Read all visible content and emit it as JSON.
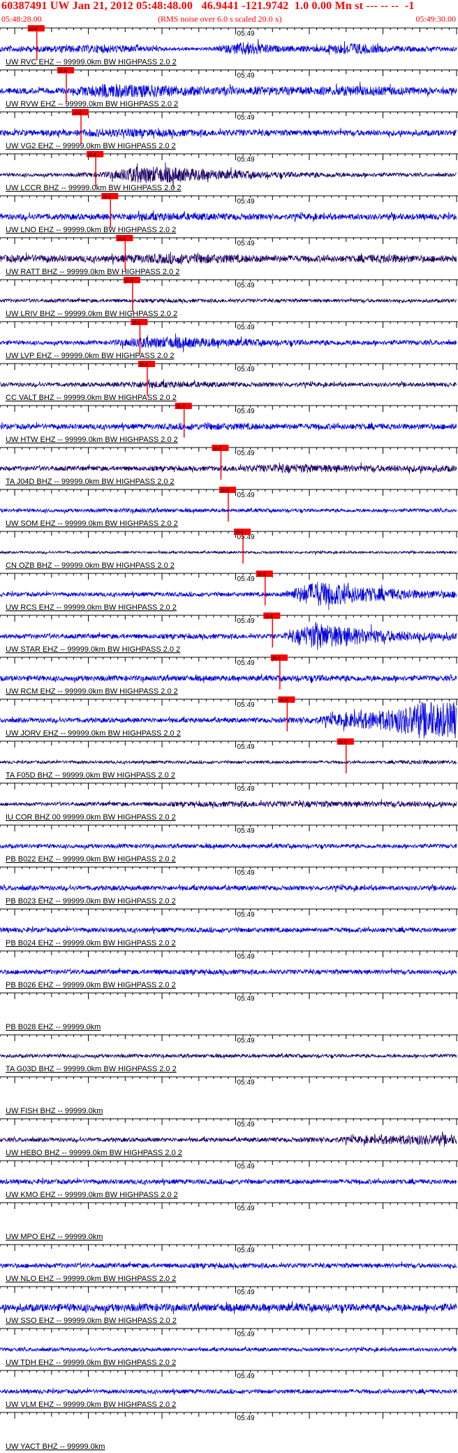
{
  "header": {
    "title": "60387491 UW Jan 21, 2012 05:48:48.00   46.9441 -121.9742  1.0 0.00 Mn st --- -- --  -1",
    "start_time": "05:48:28.00",
    "note": "(RMS noise over 6.0 s scaled 20.0 x)",
    "end_time": "05:49:30.00"
  },
  "colors": {
    "header_text": "#ff0000",
    "trace_blue": "#0000dd",
    "trace_dark": "#1a0066",
    "pick_red": "#ff0000",
    "axis_black": "#000000"
  },
  "time_axis": {
    "start": "05:48:28.00",
    "end": "05:49:30.00",
    "minute_tick_label": "05:49"
  },
  "pick_label": "st-4",
  "chart_data": {
    "type": "seismogram",
    "time_range": [
      "05:48:28.00",
      "05:49:30.00"
    ],
    "traces": [
      {
        "label": "UW RVC EHZ -- 99999.0km BW  HIGHPASS  2.0  2",
        "pick": "05:48:33",
        "onset": "05:49:03",
        "env": [
          1,
          1,
          1.2,
          1.5,
          1,
          0.6,
          0.5,
          2.5,
          1,
          1.1,
          2.2,
          1,
          0.9,
          0.8
        ],
        "color": "blue"
      },
      {
        "label": "UW RVW EHZ -- 99999.0km BW  HIGHPASS  2.0  2",
        "pick": "05:48:37",
        "onset": "05:48:37",
        "env": [
          1,
          1,
          1,
          2.5,
          2.2,
          1.8,
          1.5,
          1.3,
          1.5,
          1.4,
          1.8,
          1.5,
          1.2,
          1
        ],
        "color": "blue"
      },
      {
        "label": "UW VG2 EHZ -- 99999.0km BW  HIGHPASS  2.0  2",
        "pick": "05:48:39",
        "onset": "05:48:39",
        "env": [
          1,
          1,
          1,
          1.5,
          1.3,
          1.2,
          1.1,
          1.1,
          1,
          1,
          1,
          1,
          1,
          1
        ],
        "color": "blue"
      },
      {
        "label": "UW LCCR BHZ -- 99999.0km BW  HIGHPASS  2.0  2",
        "pick": "05:48:41",
        "onset": "05:48:41",
        "env": [
          0.6,
          0.6,
          0.6,
          1,
          3,
          2.6,
          1.8,
          1.3,
          1,
          0.9,
          0.8,
          0.7,
          0.6,
          0.6
        ],
        "color": "dark"
      },
      {
        "label": "UW LNO EHZ -- 99999.0km BW  HIGHPASS  2.0  2",
        "pick": "05:48:43",
        "onset": "05:48:43",
        "env": [
          1,
          1,
          1,
          1,
          1.4,
          1.3,
          1.2,
          1.1,
          1,
          1,
          1,
          1,
          1,
          1
        ],
        "color": "blue"
      },
      {
        "label": "UW RATT BHZ -- 99999.0km BW  HIGHPASS  2.0  2",
        "pick": "05:48:45",
        "onset": "05:48:45",
        "env": [
          1.2,
          1.3,
          1.1,
          1.1,
          1.5,
          1.8,
          1.6,
          1.3,
          1.2,
          1.1,
          1.1,
          1.6,
          1.2,
          1.1
        ],
        "color": "dark"
      },
      {
        "label": "UW LRIV BHZ -- 99999.0km BW  HIGHPASS  2.0  2",
        "pick": "05:48:46",
        "onset": "05:48:46",
        "env": [
          0.6,
          0.6,
          0.6,
          0.6,
          0.6,
          0.6,
          0.6,
          0.6,
          0.6,
          0.6,
          0.6,
          0.6,
          0.6,
          0.6
        ],
        "color": "dark"
      },
      {
        "label": "UW LVP EHZ -- 99999.0km BW  HIGHPASS  2.0  2",
        "pick": "05:48:47",
        "onset": "05:48:47",
        "env": [
          0.7,
          0.7,
          0.7,
          0.7,
          1.8,
          2,
          1.5,
          1.2,
          1,
          0.9,
          0.9,
          0.8,
          0.8,
          0.7
        ],
        "color": "blue"
      },
      {
        "label": "CC VALT BHZ -- 99999.0km BW  HIGHPASS  2.0  2",
        "pick": "05:48:48",
        "onset": "05:48:48",
        "env": [
          0.7,
          0.7,
          0.7,
          0.7,
          1.2,
          1.1,
          0.9,
          0.8,
          0.8,
          0.7,
          0.7,
          0.7,
          0.7,
          0.7
        ],
        "color": "dark"
      },
      {
        "label": "UW HTW EHZ -- 99999.0km BW  HIGHPASS  2.0  2",
        "pick": "05:48:53",
        "onset": "05:48:53",
        "env": [
          0.9,
          0.9,
          0.9,
          0.9,
          0.9,
          1,
          1.2,
          1.1,
          1,
          1,
          1,
          1,
          1,
          1
        ],
        "color": "blue"
      },
      {
        "label": "TA J04D BHZ -- 99999.0km BW  HIGHPASS  2.0  2",
        "pick": "05:48:58",
        "onset": "05:48:58",
        "env": [
          0.8,
          0.8,
          0.8,
          0.8,
          0.8,
          0.8,
          0.8,
          1.1,
          1.5,
          1.4,
          1.2,
          1.1,
          1.2,
          1.1
        ],
        "color": "dark"
      },
      {
        "label": "UW SOM EHZ -- 99999.0km BW  HIGHPASS  2.0  2",
        "pick": "05:48:59",
        "onset": "05:48:59",
        "env": [
          0.6,
          0.6,
          0.6,
          0.6,
          0.8,
          0.6,
          0.6,
          0.6,
          0.6,
          0.6,
          0.6,
          0.6,
          0.6,
          0.6
        ],
        "color": "blue"
      },
      {
        "label": "CN OZB BHZ -- 99999.0km BW  HIGHPASS  2.0  2",
        "pick": "05:49:01",
        "onset": "05:49:01",
        "env": [
          0.4,
          0.4,
          0.4,
          0.4,
          0.4,
          0.4,
          0.4,
          0.4,
          0.4,
          0.4,
          0.4,
          0.4,
          0.4,
          0.4
        ],
        "color": "dark"
      },
      {
        "label": "UW RCS EHZ -- 99999.0km BW  HIGHPASS  2.0  2",
        "pick": "05:49:04",
        "onset": "05:49:04",
        "env": [
          0.7,
          0.7,
          0.7,
          0.7,
          0.7,
          0.7,
          0.7,
          0.7,
          0.7,
          4.5,
          3,
          2,
          1.5,
          1.2
        ],
        "color": "blue"
      },
      {
        "label": "UW STAR EHZ -- 99999.0km BW  HIGHPASS  2.0  2",
        "pick": "05:49:05",
        "onset": "05:49:05",
        "env": [
          0.8,
          0.8,
          0.8,
          0.8,
          0.8,
          0.8,
          0.8,
          0.8,
          0.8,
          4.5,
          3,
          2,
          1.5,
          1.3
        ],
        "color": "blue"
      },
      {
        "label": "UW RCM EHZ -- 99999.0km BW  HIGHPASS  2.0  2",
        "pick": "05:49:06",
        "onset": "05:49:06",
        "env": [
          0.9,
          0.9,
          0.9,
          0.9,
          0.9,
          0.9,
          0.9,
          0.9,
          0.9,
          1.1,
          1,
          1,
          0.9,
          0.9
        ],
        "color": "blue"
      },
      {
        "label": "UW JORV EHZ -- 99999.0km BW  HIGHPASS  2.0  2",
        "pick": "05:49:07",
        "onset": "05:49:07",
        "env": [
          0.8,
          0.8,
          0.8,
          0.8,
          0.8,
          0.8,
          0.8,
          0.8,
          0.9,
          1.2,
          2.5,
          3.5,
          6,
          6
        ],
        "color": "blue"
      },
      {
        "label": "TA F05D BHZ -- 99999.0km BW  HIGHPASS  2.0  2",
        "pick": "05:49:15",
        "onset": "05:49:15",
        "env": [
          0.5,
          0.5,
          0.5,
          0.5,
          0.5,
          0.5,
          0.5,
          0.5,
          0.5,
          0.5,
          0.5,
          0.5,
          0.8,
          0.6
        ],
        "color": "dark"
      },
      {
        "label": "IU COR BHZ 00 99999.0km BW  HIGHPASS  2.0  2",
        "pick": null,
        "onset": null,
        "env": [
          0.6,
          0.6,
          0.6,
          0.7,
          0.7,
          0.8,
          0.9,
          1,
          1,
          1.1,
          1,
          1,
          1,
          0.9
        ],
        "color": "dark"
      },
      {
        "label": "PB B022 EHZ -- 99999.0km BW  HIGHPASS  2.0  2",
        "pick": null,
        "onset": null,
        "env": [
          0.7,
          0.7,
          0.7,
          0.7,
          0.7,
          0.7,
          0.7,
          0.7,
          0.7,
          0.7,
          0.7,
          0.7,
          0.7,
          0.7
        ],
        "color": "blue"
      },
      {
        "label": "PB B023 EHZ -- 99999.0km BW  HIGHPASS  2.0  2",
        "pick": null,
        "onset": null,
        "env": [
          0.8,
          0.8,
          0.8,
          0.8,
          0.8,
          0.8,
          0.8,
          0.8,
          0.8,
          0.8,
          0.8,
          0.8,
          0.8,
          0.8
        ],
        "color": "blue"
      },
      {
        "label": "PB B024 EHZ -- 99999.0km BW  HIGHPASS  2.0  2",
        "pick": null,
        "onset": null,
        "env": [
          0.8,
          0.8,
          0.8,
          0.8,
          0.8,
          0.8,
          0.8,
          0.8,
          0.8,
          0.8,
          0.8,
          0.8,
          0.8,
          0.8
        ],
        "color": "blue"
      },
      {
        "label": "PB B026 EHZ -- 99999.0km BW  HIGHPASS  2.0  2",
        "pick": null,
        "onset": null,
        "env": [
          0.8,
          0.8,
          0.8,
          0.8,
          0.8,
          0.9,
          0.8,
          0.8,
          0.8,
          0.8,
          0.8,
          0.8,
          0.8,
          0.8
        ],
        "color": "blue"
      },
      {
        "label": "PB B028 EHZ -- 99999.0km",
        "pick": null,
        "onset": null,
        "env": [
          0,
          0,
          0,
          0,
          0,
          0,
          0,
          0,
          0,
          0,
          0,
          0,
          0,
          0
        ],
        "color": "blue"
      },
      {
        "label": "TA G03D BHZ -- 99999.0km BW  HIGHPASS  2.0  2",
        "pick": null,
        "onset": null,
        "env": [
          0.6,
          0.6,
          0.6,
          0.6,
          0.6,
          0.6,
          0.6,
          0.6,
          0.6,
          0.6,
          0.6,
          0.6,
          0.6,
          0.6
        ],
        "color": "dark"
      },
      {
        "label": "UW FISH BHZ -- 99999.0km",
        "pick": null,
        "onset": null,
        "env": [
          0,
          0,
          0,
          0,
          0,
          0,
          0,
          0,
          0,
          0,
          0,
          0,
          0,
          0
        ],
        "color": "blue"
      },
      {
        "label": "UW HEBO BHZ -- 99999.0km BW  HIGHPASS  2.0  2",
        "pick": null,
        "onset": null,
        "env": [
          0.7,
          0.7,
          0.7,
          0.7,
          0.7,
          0.7,
          0.7,
          0.7,
          0.8,
          0.9,
          1.1,
          1.5,
          1.8,
          1.6
        ],
        "color": "dark"
      },
      {
        "label": "UW KMO EHZ -- 99999.0km BW  HIGHPASS  2.0  2",
        "pick": null,
        "onset": null,
        "env": [
          0.8,
          0.8,
          0.8,
          0.8,
          0.8,
          0.8,
          0.8,
          0.8,
          0.8,
          0.8,
          0.8,
          0.8,
          0.8,
          0.8
        ],
        "color": "blue"
      },
      {
        "label": "UW MPO EHZ -- 99999.0km",
        "pick": null,
        "onset": null,
        "env": [
          0,
          0,
          0,
          0,
          0,
          0,
          0,
          0,
          0,
          0,
          0,
          0,
          0,
          0
        ],
        "color": "blue"
      },
      {
        "label": "UW NLO EHZ -- 99999.0km BW  HIGHPASS  2.0  2",
        "pick": null,
        "onset": null,
        "env": [
          0.8,
          0.8,
          0.8,
          0.8,
          0.8,
          0.8,
          0.8,
          0.8,
          0.8,
          0.8,
          0.8,
          0.8,
          0.8,
          0.8
        ],
        "color": "blue"
      },
      {
        "label": "UW SSO EHZ -- 99999.0km BW  HIGHPASS  2.0  2",
        "pick": null,
        "onset": null,
        "env": [
          1.3,
          1.3,
          1.3,
          1.3,
          1.3,
          1.3,
          1.3,
          1.3,
          1.3,
          1.3,
          1.3,
          1.3,
          1.3,
          1.3
        ],
        "color": "blue"
      },
      {
        "label": "UW TDH EHZ -- 99999.0km BW  HIGHPASS  2.0  2",
        "pick": null,
        "onset": null,
        "env": [
          0.6,
          0.6,
          0.6,
          0.6,
          0.6,
          0.6,
          0.6,
          0.6,
          0.6,
          0.6,
          0.6,
          0.6,
          0.6,
          0.6
        ],
        "color": "blue"
      },
      {
        "label": "UW VLM EHZ -- 99999.0km BW  HIGHPASS  2.0  2",
        "pick": null,
        "onset": null,
        "env": [
          0.7,
          0.7,
          0.7,
          0.7,
          0.7,
          0.7,
          0.7,
          0.7,
          0.7,
          0.7,
          0.7,
          0.7,
          0.7,
          0.7
        ],
        "color": "blue"
      },
      {
        "label": "UW YACT BHZ -- 99999.0km",
        "pick": null,
        "onset": null,
        "env": [
          0,
          0,
          0,
          0,
          0,
          0,
          0,
          0,
          0,
          0,
          0,
          0,
          0,
          0
        ],
        "color": "blue"
      }
    ]
  }
}
